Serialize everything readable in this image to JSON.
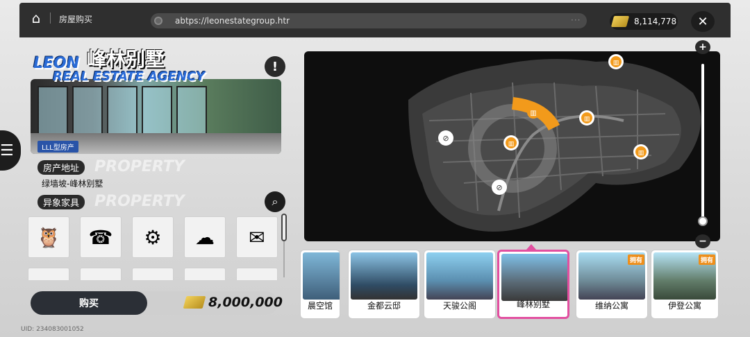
{
  "header": {
    "breadcrumb": "房屋购买",
    "url": "abtps://leonestategroup.htr",
    "url_more": "···",
    "currency": "8,114,778",
    "close_label": "✕",
    "home_icon": "home-icon"
  },
  "hero": {
    "brand_line1": "LEON",
    "brand_line2": "REAL ESTATE AGENCY",
    "title": "峰林别墅",
    "tag": "LLL型房产",
    "info_icon": "!"
  },
  "property": {
    "address_label": "房产地址",
    "address_value": "绿墙坡-峰林别墅",
    "furniture_label": "异象家具",
    "ghost_text": "PROPERTY"
  },
  "furniture_items": [
    "owl-statue",
    "red-payphone",
    "racing-motor",
    "cloud-pillow",
    "photo-postcard",
    "blue-board",
    "tool-kit",
    "wooden-tray",
    "teal-gadget",
    "brush-set"
  ],
  "purchase": {
    "buy_label": "购买",
    "price": "8,000,000"
  },
  "uid": "UID: 234083001052",
  "map": {
    "zoom_in": "+",
    "zoom_out": "−",
    "zoom_level_fraction": 0.02
  },
  "properties": [
    {
      "name": "晨空馆",
      "badge": ""
    },
    {
      "name": "金都云邸",
      "badge": ""
    },
    {
      "name": "天骏公阁",
      "badge": ""
    },
    {
      "name": "峰林别墅",
      "badge": "",
      "selected": true
    },
    {
      "name": "维纳公寓",
      "badge": "拥有"
    },
    {
      "name": "伊登公寓",
      "badge": "拥有"
    }
  ],
  "colors": {
    "accent": "#e24fa0",
    "map_marker": "#f29a1b",
    "brand_blue": "#2a6bd6"
  }
}
